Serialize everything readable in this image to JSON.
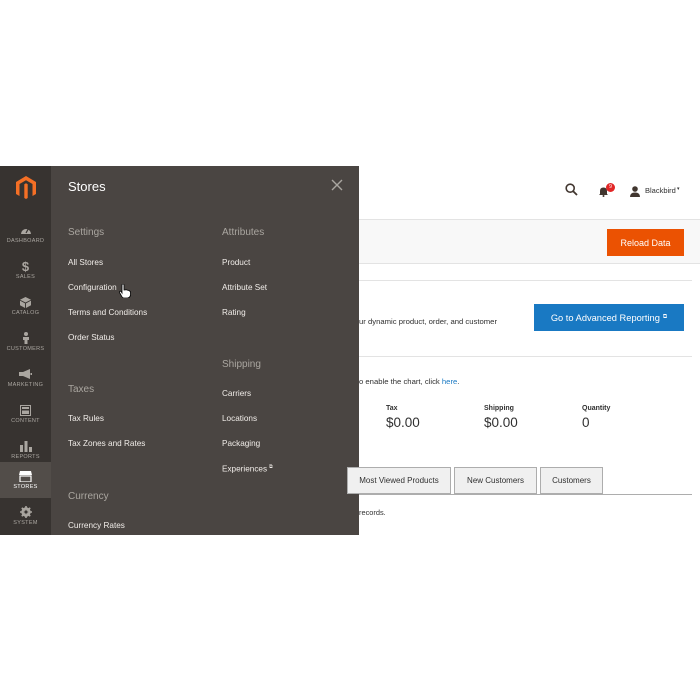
{
  "colors": {
    "sidebar_bg": "#373330",
    "flyout_bg": "#4a4542",
    "accent_orange": "#eb5202",
    "accent_blue": "#1979c3",
    "logo_orange": "#f46f25"
  },
  "sidebar": {
    "logo_icon": "magento-logo-icon",
    "items": [
      {
        "label": "DASHBOARD",
        "icon": "dashboard-gauge-icon"
      },
      {
        "label": "SALES",
        "icon": "dollar-icon"
      },
      {
        "label": "CATALOG",
        "icon": "cube-icon"
      },
      {
        "label": "CUSTOMERS",
        "icon": "person-icon"
      },
      {
        "label": "MARKETING",
        "icon": "megaphone-icon"
      },
      {
        "label": "CONTENT",
        "icon": "layout-icon"
      },
      {
        "label": "REPORTS",
        "icon": "bar-chart-icon"
      },
      {
        "label": "STORES",
        "icon": "store-icon"
      },
      {
        "label": "SYSTEM",
        "icon": "gear-icon"
      }
    ]
  },
  "flyout": {
    "title": "Stores",
    "close_icon": "close-icon",
    "settings": {
      "heading": "Settings",
      "links": [
        "All Stores",
        "Configuration",
        "Terms and Conditions",
        "Order Status"
      ]
    },
    "taxes": {
      "heading": "Taxes",
      "links": [
        "Tax Rules",
        "Tax Zones and Rates"
      ]
    },
    "currency": {
      "heading": "Currency",
      "links": [
        "Currency Rates"
      ]
    },
    "attributes": {
      "heading": "Attributes",
      "links": [
        "Product",
        "Attribute Set",
        "Rating"
      ]
    },
    "shipping": {
      "heading": "Shipping",
      "links": [
        "Carriers",
        "Locations",
        "Packaging",
        "Experiences"
      ]
    }
  },
  "header": {
    "search_icon": "search-icon",
    "notification_icon": "bell-icon",
    "notification_count": "9",
    "user_icon": "user-icon",
    "user_name": "Blackbird",
    "caret": "▾"
  },
  "actions": {
    "reload_label": "Reload Data"
  },
  "advanced": {
    "info_text": "ur dynamic product, order, and customer",
    "button_label": "Go to Advanced Reporting",
    "external_icon": "external-link-icon"
  },
  "chart_note": {
    "prefix": "o enable the chart, click ",
    "link": "here",
    "suffix": "."
  },
  "stats": [
    {
      "label": "Tax",
      "value": "$0.00"
    },
    {
      "label": "Shipping",
      "value": "$0.00"
    },
    {
      "label": "Quantity",
      "value": "0"
    }
  ],
  "tabs": [
    "Most Viewed Products",
    "New Customers",
    "Customers"
  ],
  "records_note": "records."
}
